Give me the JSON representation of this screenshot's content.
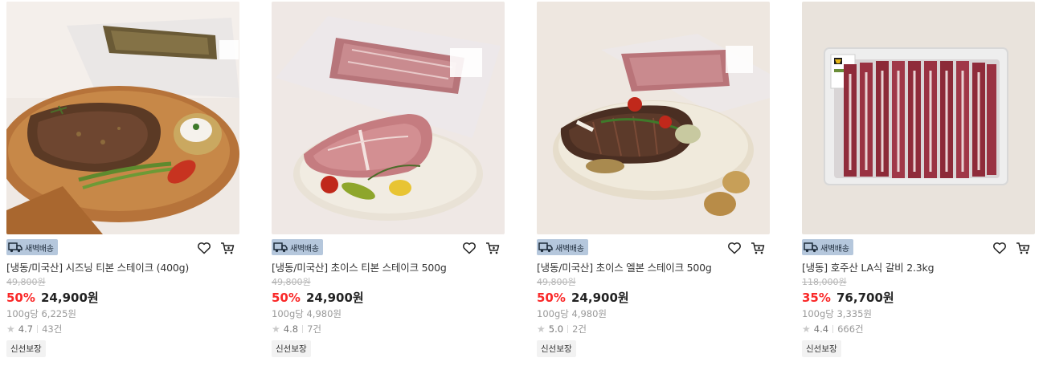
{
  "colors": {
    "discount": "#fa2828",
    "badge_bg": "#b5c7dc",
    "strike_price": "#b5b5b5"
  },
  "icons": {
    "delivery": "truck-icon",
    "wishlist": "heart-icon",
    "cart": "cart-icon",
    "rating": "star-icon"
  },
  "products": [
    {
      "image": "seasoned-tbone-steak-photo",
      "delivery_badge": "새벽배송",
      "name": "[냉동/미국산] 시즈닝 티본 스테이크 (400g)",
      "original_price": "49,800원",
      "discount_rate": "50%",
      "sale_price": "24,900원",
      "unit_price": "100g당 6,225원",
      "rating": "4.7",
      "review_count": "43건",
      "tag": "신선보장"
    },
    {
      "image": "choice-tbone-steak-photo",
      "delivery_badge": "새벽배송",
      "name": "[냉동/미국산] 초이스 티본 스테이크 500g",
      "original_price": "49,800원",
      "discount_rate": "50%",
      "sale_price": "24,900원",
      "unit_price": "100g당 4,980원",
      "rating": "4.8",
      "review_count": "7건",
      "tag": "신선보장"
    },
    {
      "image": "choice-lbone-steak-photo",
      "delivery_badge": "새벽배송",
      "name": "[냉동/미국산] 초이스 엘본 스테이크 500g",
      "original_price": "49,800원",
      "discount_rate": "50%",
      "sale_price": "24,900원",
      "unit_price": "100g당 4,980원",
      "rating": "5.0",
      "review_count": "2건",
      "tag": "신선보장"
    },
    {
      "image": "la-galbi-tray-photo",
      "delivery_badge": "새벽배송",
      "name": "[냉동] 호주산 LA식 갈비 2.3kg",
      "original_price": "118,000원",
      "discount_rate": "35%",
      "sale_price": "76,700원",
      "unit_price": "100g당 3,335원",
      "rating": "4.4",
      "review_count": "666건",
      "tag": "신선보장"
    }
  ]
}
